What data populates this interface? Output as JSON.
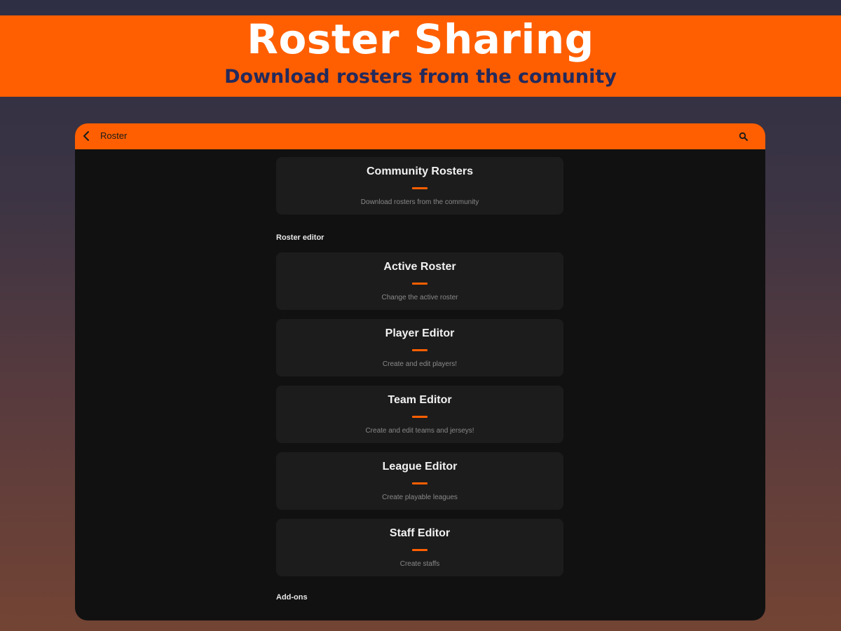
{
  "banner": {
    "title": "Roster Sharing",
    "subtitle": "Download rosters from the comunity"
  },
  "appbar": {
    "title": "Roster",
    "back_icon": "chevron-left-icon",
    "search_icon": "search-icon"
  },
  "community_card": {
    "title": "Community Rosters",
    "description": "Download rosters from the community"
  },
  "sections": {
    "roster_editor": "Roster editor",
    "addons": "Add-ons"
  },
  "editor_cards": [
    {
      "title": "Active Roster",
      "description": "Change the active roster"
    },
    {
      "title": "Player Editor",
      "description": "Create and edit players!"
    },
    {
      "title": "Team Editor",
      "description": "Create and edit teams and jerseys!"
    },
    {
      "title": "League Editor",
      "description": "Create playable leagues"
    },
    {
      "title": "Staff Editor",
      "description": "Create staffs"
    }
  ],
  "colors": {
    "accent": "#ff5f00",
    "banner_subtitle": "#232a5c",
    "app_background": "#111111",
    "card_background": "#1c1c1c"
  }
}
